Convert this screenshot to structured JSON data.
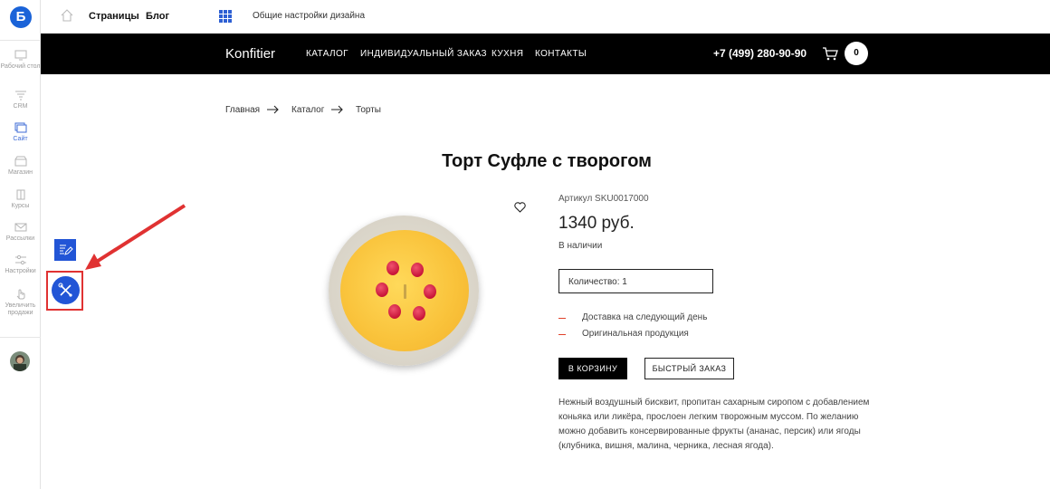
{
  "rail": {
    "logo": "Б",
    "items": [
      {
        "label": "Рабочий стол",
        "icon": "monitor-icon"
      },
      {
        "label": "CRM",
        "icon": "funnel-icon"
      },
      {
        "label": "Сайт",
        "icon": "site-icon",
        "active": true
      },
      {
        "label": "Магазин",
        "icon": "shop-icon"
      },
      {
        "label": "Курсы",
        "icon": "courses-icon"
      },
      {
        "label": "Рассылки",
        "icon": "mail-icon"
      },
      {
        "label": "Настройки",
        "icon": "settings-icon"
      },
      {
        "label": "Увеличить продажи",
        "icon": "hand-icon"
      }
    ]
  },
  "topbar": {
    "pages": "Страницы",
    "blog": "Блог",
    "design": "Общие настройки дизайна"
  },
  "site": {
    "brand": "Konfitier",
    "nav": [
      "КАТАЛОГ",
      "ИНДИВИДУАЛЬНЫЙ ЗАКАЗ",
      "КУХНЯ",
      "КОНТАКТЫ"
    ],
    "phone": "+7 (499) 280-90-90",
    "cart_count": "0"
  },
  "breadcrumb": [
    "Главная",
    "Каталог",
    "Торты"
  ],
  "product": {
    "title": "Торт Суфле с творогом",
    "sku": "Артикул SKU0017000",
    "price": "1340 руб.",
    "stock": "В наличии",
    "quantity": "Количество:  1",
    "features": [
      "Доставка на следующий день",
      "Оригинальная продукция"
    ],
    "cart_button": "В КОРЗИНУ",
    "fast_order_button": "БЫСТРЫЙ ЗАКАЗ",
    "description": "Нежный воздушный бисквит, пропитан сахарным сиропом с добавлением коньяка или ликёра, прослоен легким творожным муссом. По желанию можно добавить консервированные фрукты (ананас, персик) или ягоды (клубника, вишня, малина, черника, лесная ягода)."
  },
  "colors": {
    "accent": "#2255d6",
    "annotation": "#e03232",
    "header_bg": "#000000"
  }
}
